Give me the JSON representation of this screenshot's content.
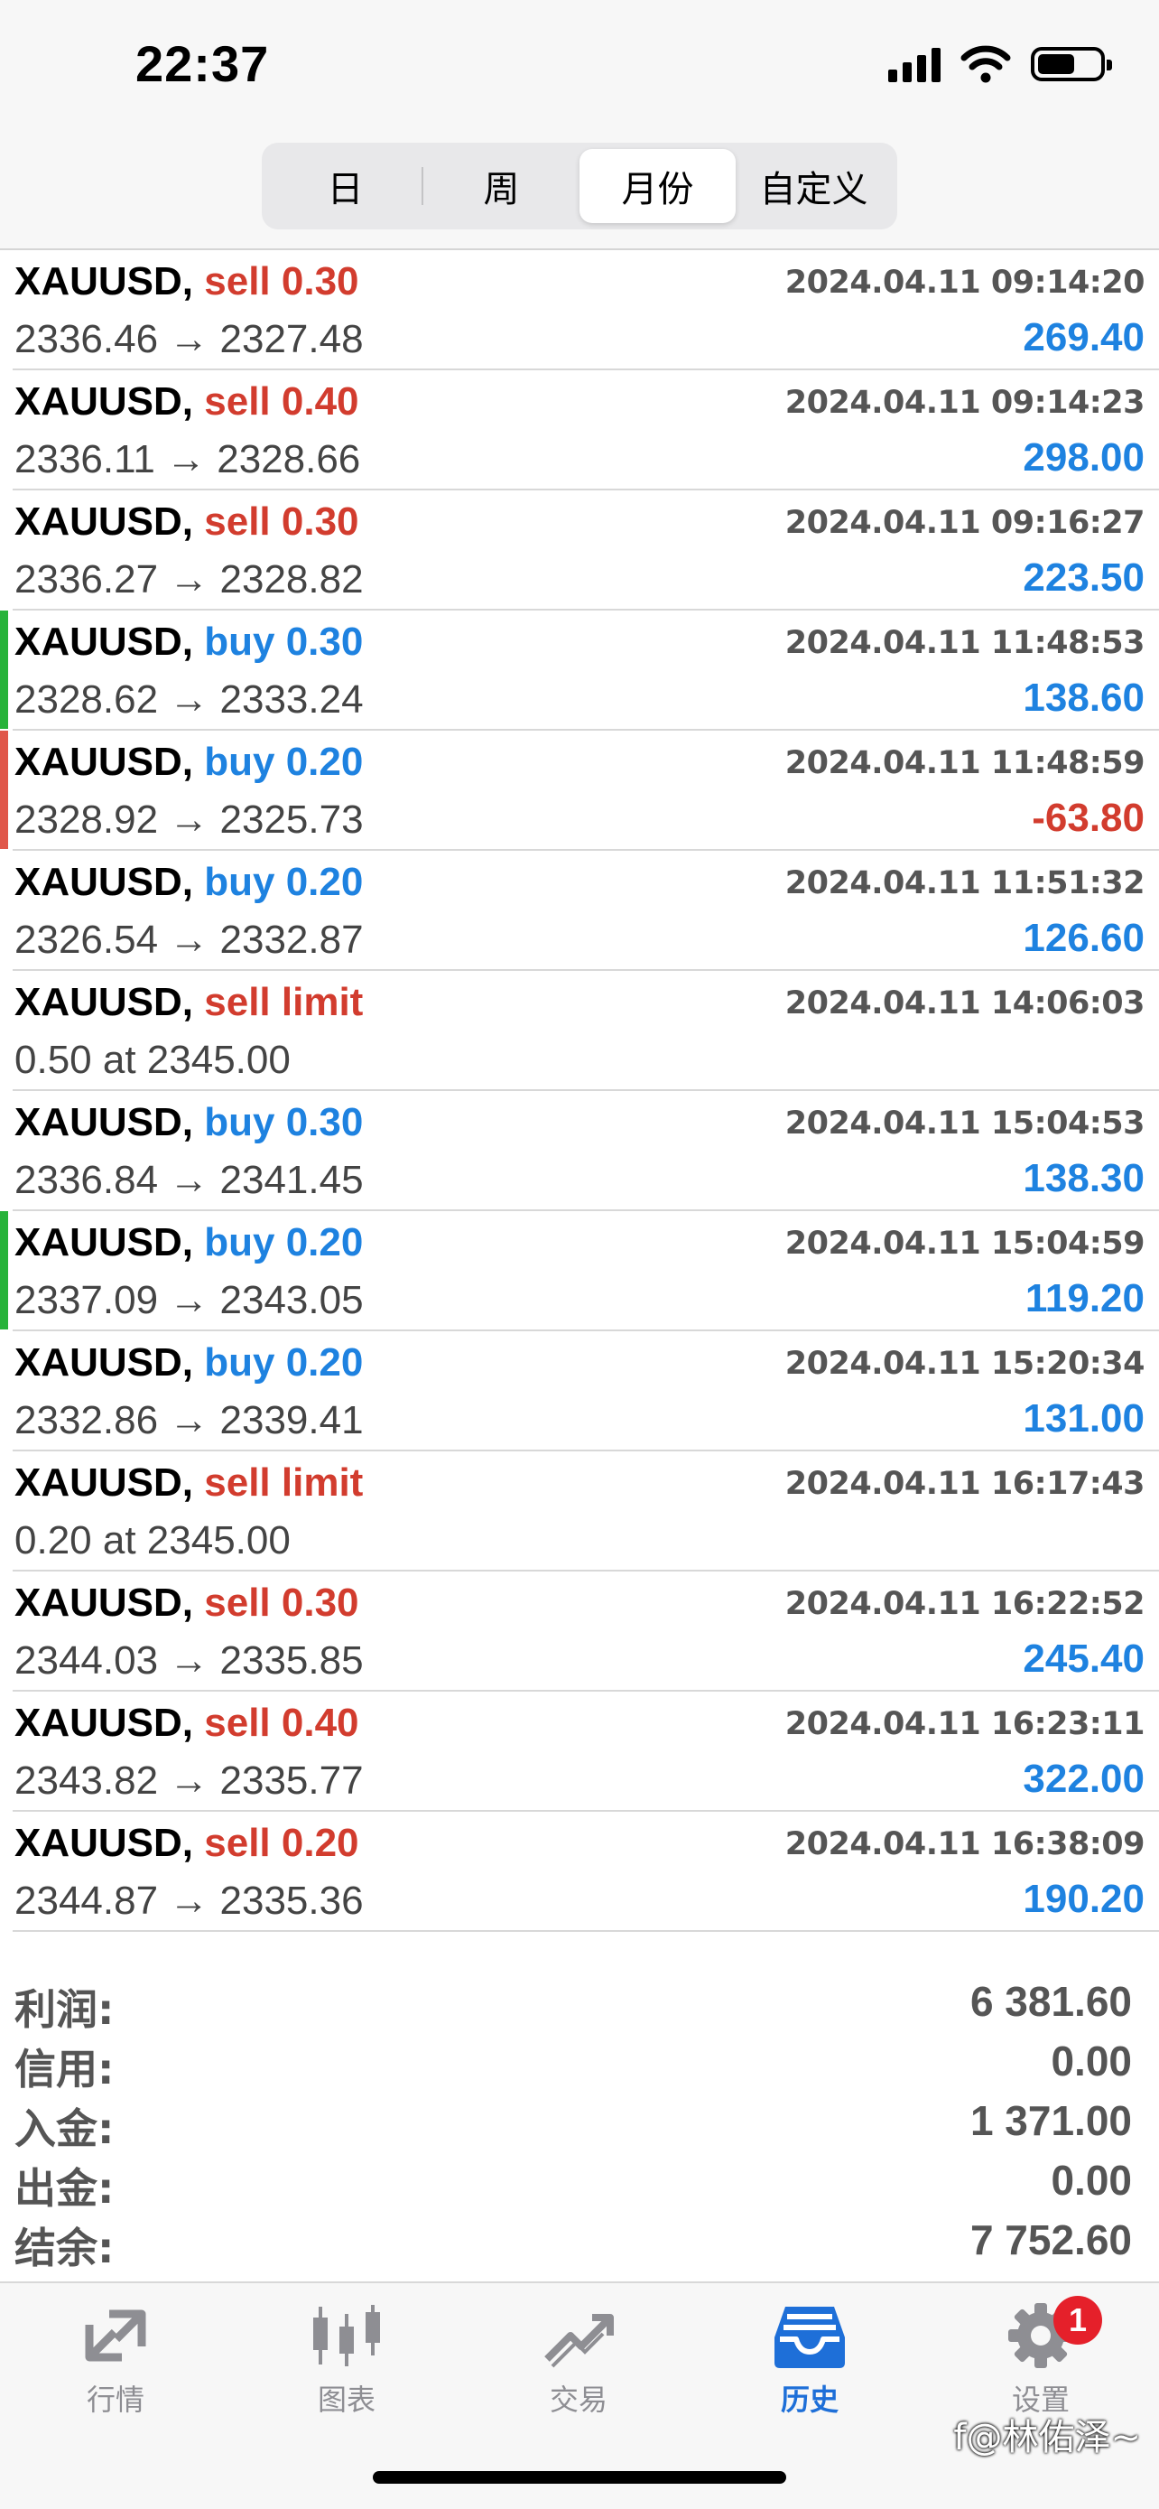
{
  "status_bar": {
    "time": "22:37"
  },
  "period_tabs": [
    {
      "label": "日",
      "active": false
    },
    {
      "label": "周",
      "active": false
    },
    {
      "label": "月份",
      "active": true
    },
    {
      "label": "自定义",
      "active": false
    }
  ],
  "trades": [
    {
      "symbol": "XAUUSD,",
      "side": "sell 0.30",
      "side_type": "sell",
      "datetime": "2024.04.11 09:14:20",
      "detail": "2336.46 → 2327.48",
      "profit": "269.40",
      "stripe": ""
    },
    {
      "symbol": "XAUUSD,",
      "side": "sell 0.40",
      "side_type": "sell",
      "datetime": "2024.04.11 09:14:23",
      "detail": "2336.11 → 2328.66",
      "profit": "298.00",
      "stripe": ""
    },
    {
      "symbol": "XAUUSD,",
      "side": "sell 0.30",
      "side_type": "sell",
      "datetime": "2024.04.11 09:16:27",
      "detail": "2336.27 → 2328.82",
      "profit": "223.50",
      "stripe": ""
    },
    {
      "symbol": "XAUUSD,",
      "side": "buy 0.30",
      "side_type": "buy",
      "datetime": "2024.04.11 11:48:53",
      "detail": "2328.62 → 2333.24",
      "profit": "138.60",
      "stripe": "#27b33a"
    },
    {
      "symbol": "XAUUSD,",
      "side": "buy 0.20",
      "side_type": "buy",
      "datetime": "2024.04.11 11:48:59",
      "detail": "2328.92 → 2325.73",
      "profit": "-63.80",
      "stripe": "#e0574a"
    },
    {
      "symbol": "XAUUSD,",
      "side": "buy 0.20",
      "side_type": "buy",
      "datetime": "2024.04.11 11:51:32",
      "detail": "2326.54 → 2332.87",
      "profit": "126.60",
      "stripe": ""
    },
    {
      "symbol": "XAUUSD,",
      "side": "sell limit",
      "side_type": "sell",
      "datetime": "2024.04.11 14:06:03",
      "detail": "0.50 at 2345.00",
      "profit": "",
      "stripe": ""
    },
    {
      "symbol": "XAUUSD,",
      "side": "buy 0.30",
      "side_type": "buy",
      "datetime": "2024.04.11 15:04:53",
      "detail": "2336.84 → 2341.45",
      "profit": "138.30",
      "stripe": ""
    },
    {
      "symbol": "XAUUSD,",
      "side": "buy 0.20",
      "side_type": "buy",
      "datetime": "2024.04.11 15:04:59",
      "detail": "2337.09 → 2343.05",
      "profit": "119.20",
      "stripe": "#27b33a"
    },
    {
      "symbol": "XAUUSD,",
      "side": "buy 0.20",
      "side_type": "buy",
      "datetime": "2024.04.11 15:20:34",
      "detail": "2332.86 → 2339.41",
      "profit": "131.00",
      "stripe": ""
    },
    {
      "symbol": "XAUUSD,",
      "side": "sell limit",
      "side_type": "sell",
      "datetime": "2024.04.11 16:17:43",
      "detail": "0.20 at 2345.00",
      "profit": "",
      "stripe": ""
    },
    {
      "symbol": "XAUUSD,",
      "side": "sell 0.30",
      "side_type": "sell",
      "datetime": "2024.04.11 16:22:52",
      "detail": "2344.03 → 2335.85",
      "profit": "245.40",
      "stripe": ""
    },
    {
      "symbol": "XAUUSD,",
      "side": "sell 0.40",
      "side_type": "sell",
      "datetime": "2024.04.11 16:23:11",
      "detail": "2343.82 → 2335.77",
      "profit": "322.00",
      "stripe": ""
    },
    {
      "symbol": "XAUUSD,",
      "side": "sell 0.20",
      "side_type": "sell",
      "datetime": "2024.04.11 16:38:09",
      "detail": "2344.87 → 2335.36",
      "profit": "190.20",
      "stripe": ""
    }
  ],
  "summary": [
    {
      "label": "利润:",
      "value": "6 381.60"
    },
    {
      "label": "信用:",
      "value": "0.00"
    },
    {
      "label": "入金:",
      "value": "1 371.00"
    },
    {
      "label": "出金:",
      "value": "0.00"
    },
    {
      "label": "结余:",
      "value": "7 752.60"
    }
  ],
  "tab_bar": [
    {
      "label": "行情",
      "icon": "quotes-arrows-icon",
      "active": false
    },
    {
      "label": "图表",
      "icon": "candlestick-chart-icon",
      "active": false
    },
    {
      "label": "交易",
      "icon": "trade-trend-icon",
      "active": false
    },
    {
      "label": "历史",
      "icon": "history-inbox-icon",
      "active": true
    },
    {
      "label": "设置",
      "icon": "gear-icon",
      "active": false,
      "badge": "1"
    }
  ],
  "watermark": "f@林佑泽~",
  "colors": {
    "sell": "#d23c2e",
    "buy": "#1e82e0",
    "active_tab": "#1e6fd8",
    "badge": "#e5202a"
  }
}
